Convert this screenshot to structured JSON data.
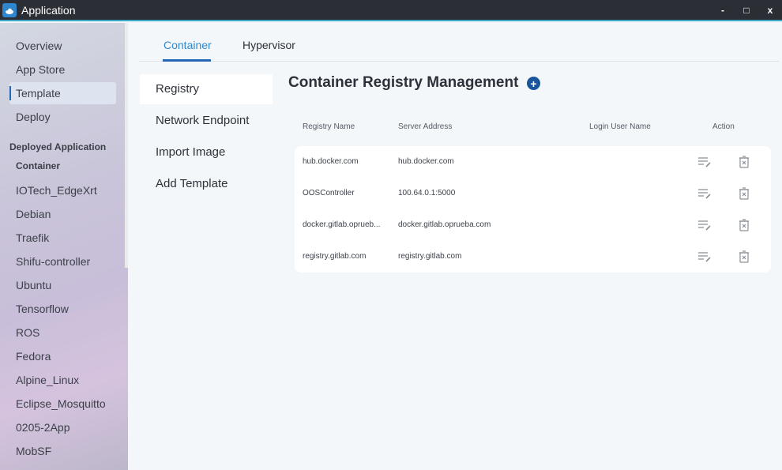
{
  "window": {
    "title": "Application",
    "controls": {
      "minimize": "-",
      "maximize": "□",
      "close": "x"
    }
  },
  "sidebar": {
    "items": [
      {
        "label": "Overview"
      },
      {
        "label": "App Store"
      },
      {
        "label": "Template",
        "active": true
      },
      {
        "label": "Deploy"
      }
    ],
    "section_label": "Deployed Application",
    "sub_label": "Container",
    "apps": [
      "IOTech_EdgeXrt",
      "Debian",
      "Traefik",
      "Shifu-controller",
      "Ubuntu",
      "Tensorflow",
      "ROS",
      "Fedora",
      "Alpine_Linux",
      "Eclipse_Mosquitto",
      "0205-2App",
      "MobSF"
    ]
  },
  "tabs": [
    {
      "label": "Container",
      "active": true
    },
    {
      "label": "Hypervisor"
    }
  ],
  "subnav": [
    {
      "label": "Registry",
      "active": true
    },
    {
      "label": "Network Endpoint"
    },
    {
      "label": "Import Image"
    },
    {
      "label": "Add Template"
    }
  ],
  "content": {
    "title": "Container Registry Management",
    "add_icon": "plus-circle-icon",
    "columns": [
      "Registry Name",
      "Server Address",
      "Login User Name",
      "Action"
    ],
    "rows": [
      {
        "name": "hub.docker.com",
        "server": "hub.docker.com",
        "user": ""
      },
      {
        "name": "OOSController",
        "server": "100.64.0.1:5000",
        "user": ""
      },
      {
        "name": "docker.gitlab.oprueb...",
        "server": "docker.gitlab.oprueba.com",
        "user": ""
      },
      {
        "name": "registry.gitlab.com",
        "server": "registry.gitlab.com",
        "user": ""
      }
    ],
    "row_actions": [
      "edit-icon",
      "delete-icon"
    ]
  },
  "colors": {
    "accent": "#2567b5",
    "tab_active_text": "#3088cc",
    "titlebar": "#2b2f35",
    "titlebar_border": "#3ba7c4"
  }
}
